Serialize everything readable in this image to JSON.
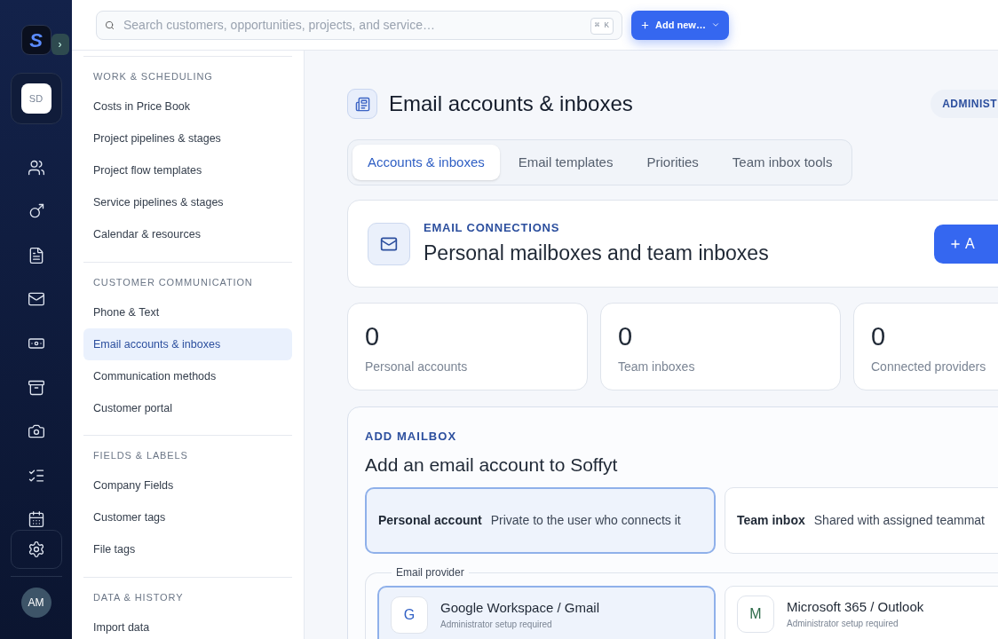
{
  "rail": {
    "logo": "S",
    "expand": "›",
    "workspace": "SD",
    "items": [
      {
        "selected": false
      },
      {
        "selected": false
      },
      {
        "selected": false
      },
      {
        "selected": false
      },
      {
        "selected": false
      },
      {
        "selected": false
      },
      {
        "selected": false
      },
      {
        "selected": false
      },
      {
        "selected": false
      }
    ],
    "user": "AM"
  },
  "topbar": {
    "search": {
      "placeholder": "Search customers, opportunities, projects, and service…",
      "shortcut": "⌘ K"
    },
    "add_button": "Add new…"
  },
  "settings_nav": [
    {
      "title": "WORK & SCHEDULING",
      "items": [
        {
          "label": "Costs in Price Book",
          "selected": false
        },
        {
          "label": "Project pipelines & stages",
          "selected": false
        },
        {
          "label": "Project flow templates",
          "selected": false
        },
        {
          "label": "Service pipelines & stages",
          "selected": false
        },
        {
          "label": "Calendar & resources",
          "selected": false
        }
      ]
    },
    {
      "title": "CUSTOMER COMMUNICATION",
      "items": [
        {
          "label": "Phone & Text",
          "selected": false
        },
        {
          "label": "Email accounts & inboxes",
          "selected": true
        },
        {
          "label": "Communication methods",
          "selected": false
        },
        {
          "label": "Customer portal",
          "selected": false
        }
      ]
    },
    {
      "title": "FIELDS & LABELS",
      "items": [
        {
          "label": "Company Fields",
          "selected": false
        },
        {
          "label": "Customer tags",
          "selected": false
        },
        {
          "label": "File tags",
          "selected": false
        }
      ]
    },
    {
      "title": "DATA & HISTORY",
      "items": [
        {
          "label": "Import data",
          "selected": false
        }
      ]
    }
  ],
  "page": {
    "title": "Email accounts & inboxes",
    "badge": "ADMINIST",
    "tabs": [
      {
        "label": "Accounts & inboxes",
        "selected": true
      },
      {
        "label": "Email templates",
        "selected": false
      },
      {
        "label": "Priorities",
        "selected": false
      },
      {
        "label": "Team inbox tools",
        "selected": false
      }
    ],
    "connections": {
      "eyebrow": "EMAIL CONNECTIONS",
      "title": "Personal mailboxes and team inboxes",
      "button": "A"
    },
    "stats": [
      {
        "value": "0",
        "label": "Personal accounts"
      },
      {
        "value": "0",
        "label": "Team inboxes"
      },
      {
        "value": "0",
        "label": "Connected providers"
      }
    ],
    "add_mailbox": {
      "eyebrow": "ADD MAILBOX",
      "title": "Add an email account to Soffyt",
      "types": [
        {
          "name": "Personal account",
          "description": "Private to the user who connects it",
          "selected": true
        },
        {
          "name": "Team inbox",
          "description": "Shared with assigned teammat",
          "selected": false
        }
      ],
      "provider_legend": "Email provider",
      "providers": [
        {
          "letter": "G",
          "name": "Google Workspace / Gmail",
          "note": "Administrator setup required",
          "selected": true,
          "color": "#2f5fc4"
        },
        {
          "letter": "M",
          "name": "Microsoft 365 / Outlook",
          "note": "Administrator setup required",
          "selected": false,
          "color": "#2e6b4a"
        }
      ]
    }
  }
}
